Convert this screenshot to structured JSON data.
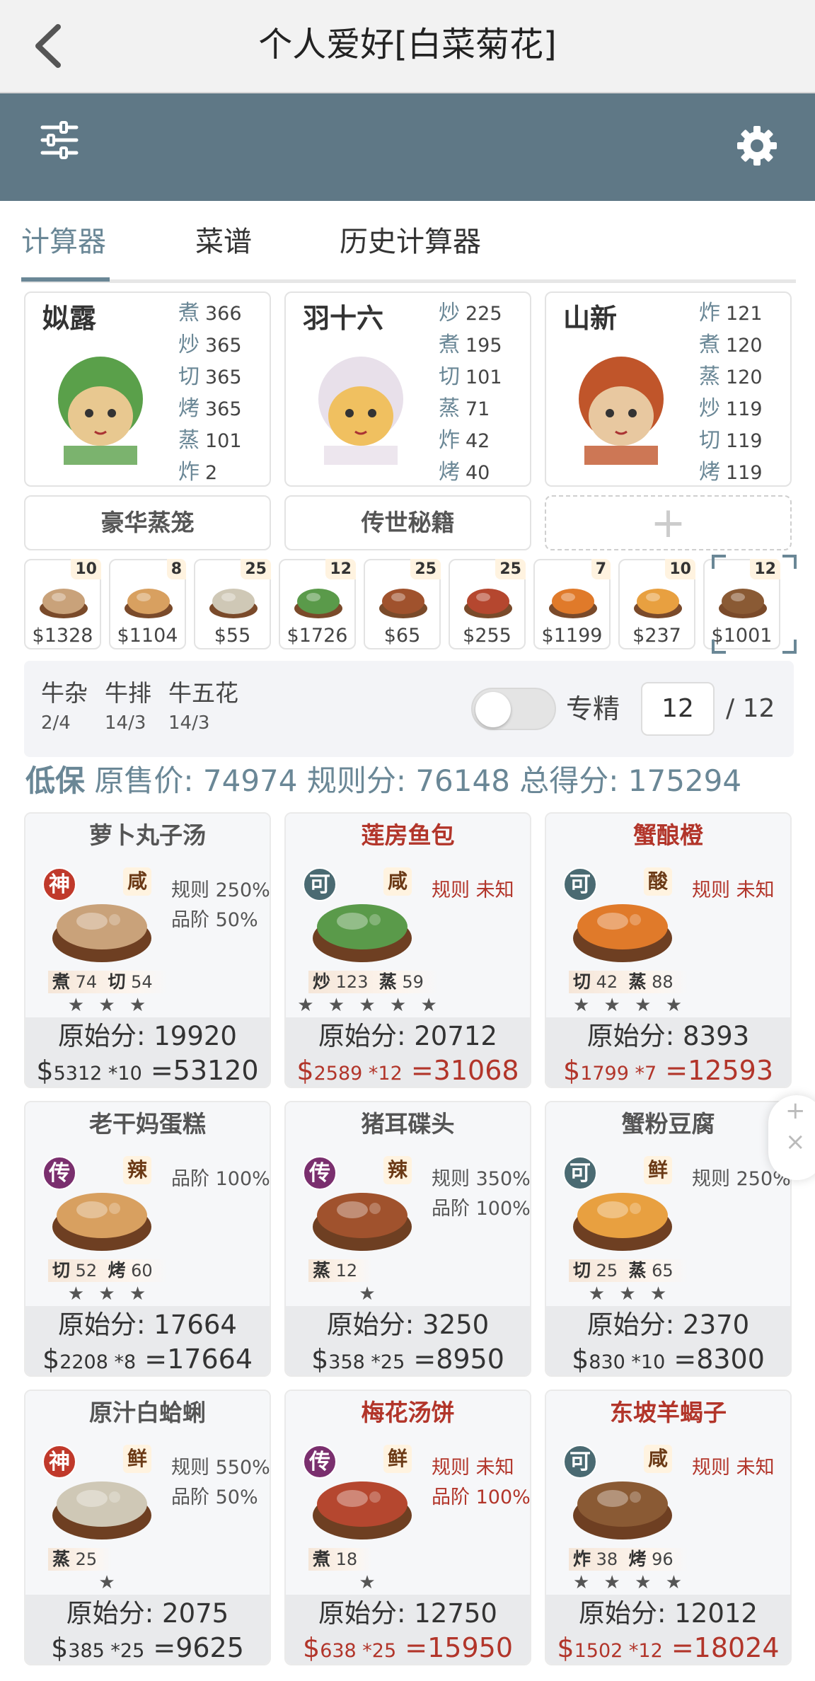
{
  "header": {
    "title": "个人爱好[白菜菊花]"
  },
  "tabs": [
    "计算器",
    "菜谱",
    "历史计算器"
  ],
  "chefs": [
    {
      "name": "姒露",
      "stats": [
        [
          "煮",
          "366"
        ],
        [
          "炒",
          "365"
        ],
        [
          "切",
          "365"
        ],
        [
          "烤",
          "365"
        ],
        [
          "蒸",
          "101"
        ],
        [
          "炸",
          "2"
        ]
      ]
    },
    {
      "name": "羽十六",
      "stats": [
        [
          "炒",
          "225"
        ],
        [
          "煮",
          "195"
        ],
        [
          "切",
          "101"
        ],
        [
          "蒸",
          "71"
        ],
        [
          "炸",
          "42"
        ],
        [
          "烤",
          "40"
        ]
      ]
    },
    {
      "name": "山新",
      "stats": [
        [
          "炸",
          "121"
        ],
        [
          "煮",
          "120"
        ],
        [
          "蒸",
          "120"
        ],
        [
          "炒",
          "119"
        ],
        [
          "切",
          "119"
        ],
        [
          "烤",
          "119"
        ]
      ]
    }
  ],
  "equips": [
    "豪华蒸笼",
    "传世秘籍",
    "+"
  ],
  "ingredients": [
    {
      "count": "10",
      "price": "$1328",
      "color": "#c9a27a"
    },
    {
      "count": "8",
      "price": "$1104",
      "color": "#d8a060"
    },
    {
      "count": "25",
      "price": "$55",
      "color": "#cfc8b6"
    },
    {
      "count": "12",
      "price": "$1726",
      "color": "#5a9a4a"
    },
    {
      "count": "25",
      "price": "$65",
      "color": "#a0522d"
    },
    {
      "count": "25",
      "price": "$255",
      "color": "#b5472f"
    },
    {
      "count": "7",
      "price": "$1199",
      "color": "#e07a2a"
    },
    {
      "count": "10",
      "price": "$237",
      "color": "#e8a040"
    },
    {
      "count": "12",
      "price": "$1001",
      "color": "#8a5a34"
    }
  ],
  "group": [
    {
      "name": "牛杂",
      "count": "2/4"
    },
    {
      "name": "牛排",
      "count": "14/3"
    },
    {
      "name": "牛五花",
      "count": "14/3"
    }
  ],
  "specialize": {
    "label": "专精",
    "value": "12",
    "total": "/ 12"
  },
  "summary": {
    "label": "低保",
    "text": "原售价:  74974 规则分:  76148 总得分:  175294"
  },
  "dishes": [
    {
      "name": "萝卜丸子汤",
      "red": false,
      "rarity": "神",
      "rcolor": "#c0392b",
      "flavor": "咸",
      "rule": [
        "规则 250%",
        "品阶 50%"
      ],
      "ruleRed": false,
      "skills": [
        [
          "煮",
          "74"
        ],
        [
          "切",
          "54"
        ]
      ],
      "stars": "★ ★ ★",
      "orig": "原始分: 19920",
      "calc": [
        "$",
        "5312 *10",
        "=53120"
      ],
      "calcRed": false,
      "color": "#c9a27a"
    },
    {
      "name": "莲房鱼包",
      "red": true,
      "rarity": "可",
      "rcolor": "#4a6a72",
      "flavor": "咸",
      "rule": [
        "规则 未知"
      ],
      "ruleRed": true,
      "skills": [
        [
          "炒",
          "123"
        ],
        [
          "蒸",
          "59"
        ]
      ],
      "stars": "★ ★ ★ ★ ★",
      "orig": "原始分: 20712",
      "calc": [
        "$",
        "2589 *12",
        "=31068"
      ],
      "calcRed": true,
      "color": "#5a9a4a"
    },
    {
      "name": "蟹酿橙",
      "red": true,
      "rarity": "可",
      "rcolor": "#4a6a72",
      "flavor": "酸",
      "rule": [
        "规则 未知"
      ],
      "ruleRed": true,
      "skills": [
        [
          "切",
          "42"
        ],
        [
          "蒸",
          "88"
        ]
      ],
      "stars": "★ ★ ★ ★",
      "orig": "原始分: 8393",
      "calc": [
        "$",
        "1799 *7",
        "=12593"
      ],
      "calcRed": true,
      "color": "#e07a2a"
    },
    {
      "name": "老干妈蛋糕",
      "red": false,
      "rarity": "传",
      "rcolor": "#7a2f6e",
      "flavor": "辣",
      "rule": [
        "品阶 100%"
      ],
      "ruleRed": false,
      "skills": [
        [
          "切",
          "52"
        ],
        [
          "烤",
          "60"
        ]
      ],
      "stars": "★ ★ ★",
      "orig": "原始分: 17664",
      "calc": [
        "$",
        "2208 *8",
        "=17664"
      ],
      "calcRed": false,
      "color": "#d8a060"
    },
    {
      "name": "猪耳碟头",
      "red": false,
      "rarity": "传",
      "rcolor": "#7a2f6e",
      "flavor": "辣",
      "rule": [
        "规则 350%",
        "品阶 100%"
      ],
      "ruleRed": false,
      "skills": [
        [
          "蒸",
          "12"
        ]
      ],
      "stars": "★",
      "orig": "原始分: 3250",
      "calc": [
        "$",
        "358 *25",
        "=8950"
      ],
      "calcRed": false,
      "color": "#a0522d"
    },
    {
      "name": "蟹粉豆腐",
      "red": false,
      "rarity": "可",
      "rcolor": "#4a6a72",
      "flavor": "鲜",
      "rule": [
        "规则 250%"
      ],
      "ruleRed": false,
      "skills": [
        [
          "切",
          "25"
        ],
        [
          "蒸",
          "65"
        ]
      ],
      "stars": "★ ★ ★",
      "orig": "原始分: 2370",
      "calc": [
        "$",
        "830 *10",
        "=8300"
      ],
      "calcRed": false,
      "color": "#e8a040"
    },
    {
      "name": "原汁白蛤蜊",
      "red": false,
      "rarity": "神",
      "rcolor": "#c0392b",
      "flavor": "鲜",
      "rule": [
        "规则 550%",
        "品阶 50%"
      ],
      "ruleRed": false,
      "skills": [
        [
          "蒸",
          "25"
        ]
      ],
      "stars": "★",
      "orig": "原始分: 2075",
      "calc": [
        "$",
        "385 *25",
        "=9625"
      ],
      "calcRed": false,
      "color": "#cfc8b6"
    },
    {
      "name": "梅花汤饼",
      "red": true,
      "rarity": "传",
      "rcolor": "#7a2f6e",
      "flavor": "鲜",
      "rule": [
        "规则 未知",
        "品阶 100%"
      ],
      "ruleRed": true,
      "skills": [
        [
          "煮",
          "18"
        ]
      ],
      "stars": "★",
      "orig": "原始分: 12750",
      "calc": [
        "$",
        "638 *25",
        "=15950"
      ],
      "calcRed": true,
      "color": "#b5472f"
    },
    {
      "name": "东坡羊蝎子",
      "red": true,
      "rarity": "可",
      "rcolor": "#4a6a72",
      "flavor": "咸",
      "rule": [
        "规则 未知"
      ],
      "ruleRed": true,
      "skills": [
        [
          "炸",
          "38"
        ],
        [
          "烤",
          "96"
        ]
      ],
      "stars": "★ ★ ★ ★",
      "orig": "原始分: 12012",
      "calc": [
        "$",
        "1502 *12",
        "=18024"
      ],
      "calcRed": true,
      "color": "#8a5a34"
    }
  ]
}
